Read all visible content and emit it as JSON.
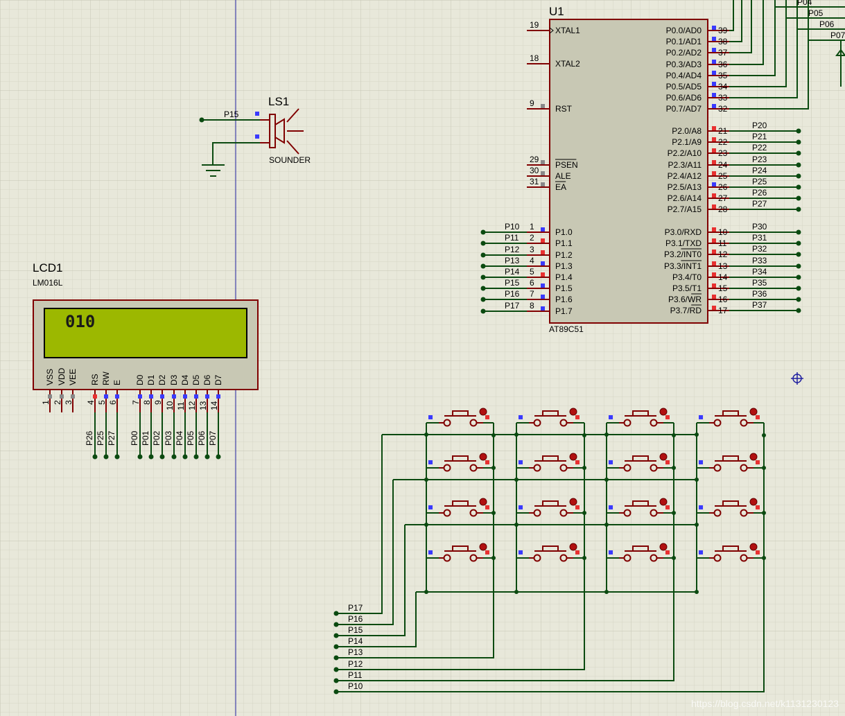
{
  "u1": {
    "ref": "U1",
    "part": "AT89C51",
    "left_pins": [
      {
        "num": "19",
        "label": "XTAL1",
        "net": ""
      },
      {
        "num": "18",
        "label": "XTAL2",
        "net": ""
      },
      {
        "num": "9",
        "label": "RST",
        "net": ""
      },
      {
        "num": "29",
        "label": "PSEN",
        "net": "",
        "overbar": true
      },
      {
        "num": "30",
        "label": "ALE",
        "net": ""
      },
      {
        "num": "31",
        "label": "EA",
        "net": "",
        "overbar": true
      },
      {
        "num": "1",
        "label": "P1.0",
        "net": "P10"
      },
      {
        "num": "2",
        "label": "P1.1",
        "net": "P11"
      },
      {
        "num": "3",
        "label": "P1.2",
        "net": "P12"
      },
      {
        "num": "4",
        "label": "P1.3",
        "net": "P13"
      },
      {
        "num": "5",
        "label": "P1.4",
        "net": "P14"
      },
      {
        "num": "6",
        "label": "P1.5",
        "net": "P15"
      },
      {
        "num": "7",
        "label": "P1.6",
        "net": "P16"
      },
      {
        "num": "8",
        "label": "P1.7",
        "net": "P17"
      }
    ],
    "right_pins": [
      {
        "num": "39",
        "label": "P0.0/AD0",
        "net": ""
      },
      {
        "num": "38",
        "label": "P0.1/AD1",
        "net": ""
      },
      {
        "num": "37",
        "label": "P0.2/AD2",
        "net": ""
      },
      {
        "num": "36",
        "label": "P0.3/AD3",
        "net": ""
      },
      {
        "num": "35",
        "label": "P0.4/AD4",
        "net": ""
      },
      {
        "num": "34",
        "label": "P0.5/AD5",
        "net": ""
      },
      {
        "num": "33",
        "label": "P0.6/AD6",
        "net": ""
      },
      {
        "num": "32",
        "label": "P0.7/AD7",
        "net": ""
      },
      {
        "num": "21",
        "label": "P2.0/A8",
        "net": "P20"
      },
      {
        "num": "22",
        "label": "P2.1/A9",
        "net": "P21"
      },
      {
        "num": "23",
        "label": "P2.2/A10",
        "net": "P22"
      },
      {
        "num": "24",
        "label": "P2.3/A11",
        "net": "P23"
      },
      {
        "num": "25",
        "label": "P2.4/A12",
        "net": "P24"
      },
      {
        "num": "26",
        "label": "P2.5/A13",
        "net": "P25"
      },
      {
        "num": "27",
        "label": "P2.6/A14",
        "net": "P26"
      },
      {
        "num": "28",
        "label": "P2.7/A15",
        "net": "P27"
      },
      {
        "num": "10",
        "label": "P3.0/RXD",
        "net": "P30"
      },
      {
        "num": "11",
        "label": "P3.1/TXD",
        "net": "P31"
      },
      {
        "num": "12",
        "label": "P3.2/INT0",
        "net": "P32",
        "overbar_part": "INT0"
      },
      {
        "num": "13",
        "label": "P3.3/INT1",
        "net": "P33",
        "overbar_part": "INT1"
      },
      {
        "num": "14",
        "label": "P3.4/T0",
        "net": "P34"
      },
      {
        "num": "15",
        "label": "P3.5/T1",
        "net": "P35"
      },
      {
        "num": "16",
        "label": "P3.6/WR",
        "net": "P36",
        "overbar_part": "WR"
      },
      {
        "num": "17",
        "label": "P3.7/RD",
        "net": "P37",
        "overbar_part": "RD"
      }
    ],
    "p0_nets": [
      "P04",
      "P05",
      "P06",
      "P07"
    ]
  },
  "ls1": {
    "ref": "LS1",
    "part": "SOUNDER",
    "net": "P15"
  },
  "lcd1": {
    "ref": "LCD1",
    "part": "LM016L",
    "display_text": "010",
    "pins": [
      {
        "num": "1",
        "label": "VSS",
        "net": ""
      },
      {
        "num": "2",
        "label": "VDD",
        "net": ""
      },
      {
        "num": "3",
        "label": "VEE",
        "net": ""
      },
      {
        "num": "4",
        "label": "RS",
        "net": "P26"
      },
      {
        "num": "5",
        "label": "RW",
        "net": "P25"
      },
      {
        "num": "6",
        "label": "E",
        "net": "P27"
      },
      {
        "num": "7",
        "label": "D0",
        "net": "P00"
      },
      {
        "num": "8",
        "label": "D1",
        "net": "P01"
      },
      {
        "num": "9",
        "label": "D2",
        "net": "P02"
      },
      {
        "num": "10",
        "label": "D3",
        "net": "P03"
      },
      {
        "num": "11",
        "label": "D4",
        "net": "P04"
      },
      {
        "num": "12",
        "label": "D5",
        "net": "P05"
      },
      {
        "num": "13",
        "label": "D6",
        "net": "P06"
      },
      {
        "num": "14",
        "label": "D7",
        "net": "P07"
      }
    ]
  },
  "keypad": {
    "rows": 4,
    "cols": 4,
    "nets": [
      "P17",
      "P16",
      "P15",
      "P14",
      "P13",
      "P12",
      "P11",
      "P10"
    ]
  },
  "watermark": "https://blog.csdn.net/k1131230123",
  "colors": {
    "background": "#e8e8da",
    "grid": "#d4d4c4",
    "grid_major": "#c4c4b2",
    "component": "#800000",
    "body_fill": "#c8c8b4",
    "wire": "#0b4a10",
    "lcd_screen": "#9cb800",
    "pin_red": "#e83030",
    "pin_blue": "#3a3aff",
    "pin_grey": "#888888",
    "crosshair": "#2020a0"
  }
}
